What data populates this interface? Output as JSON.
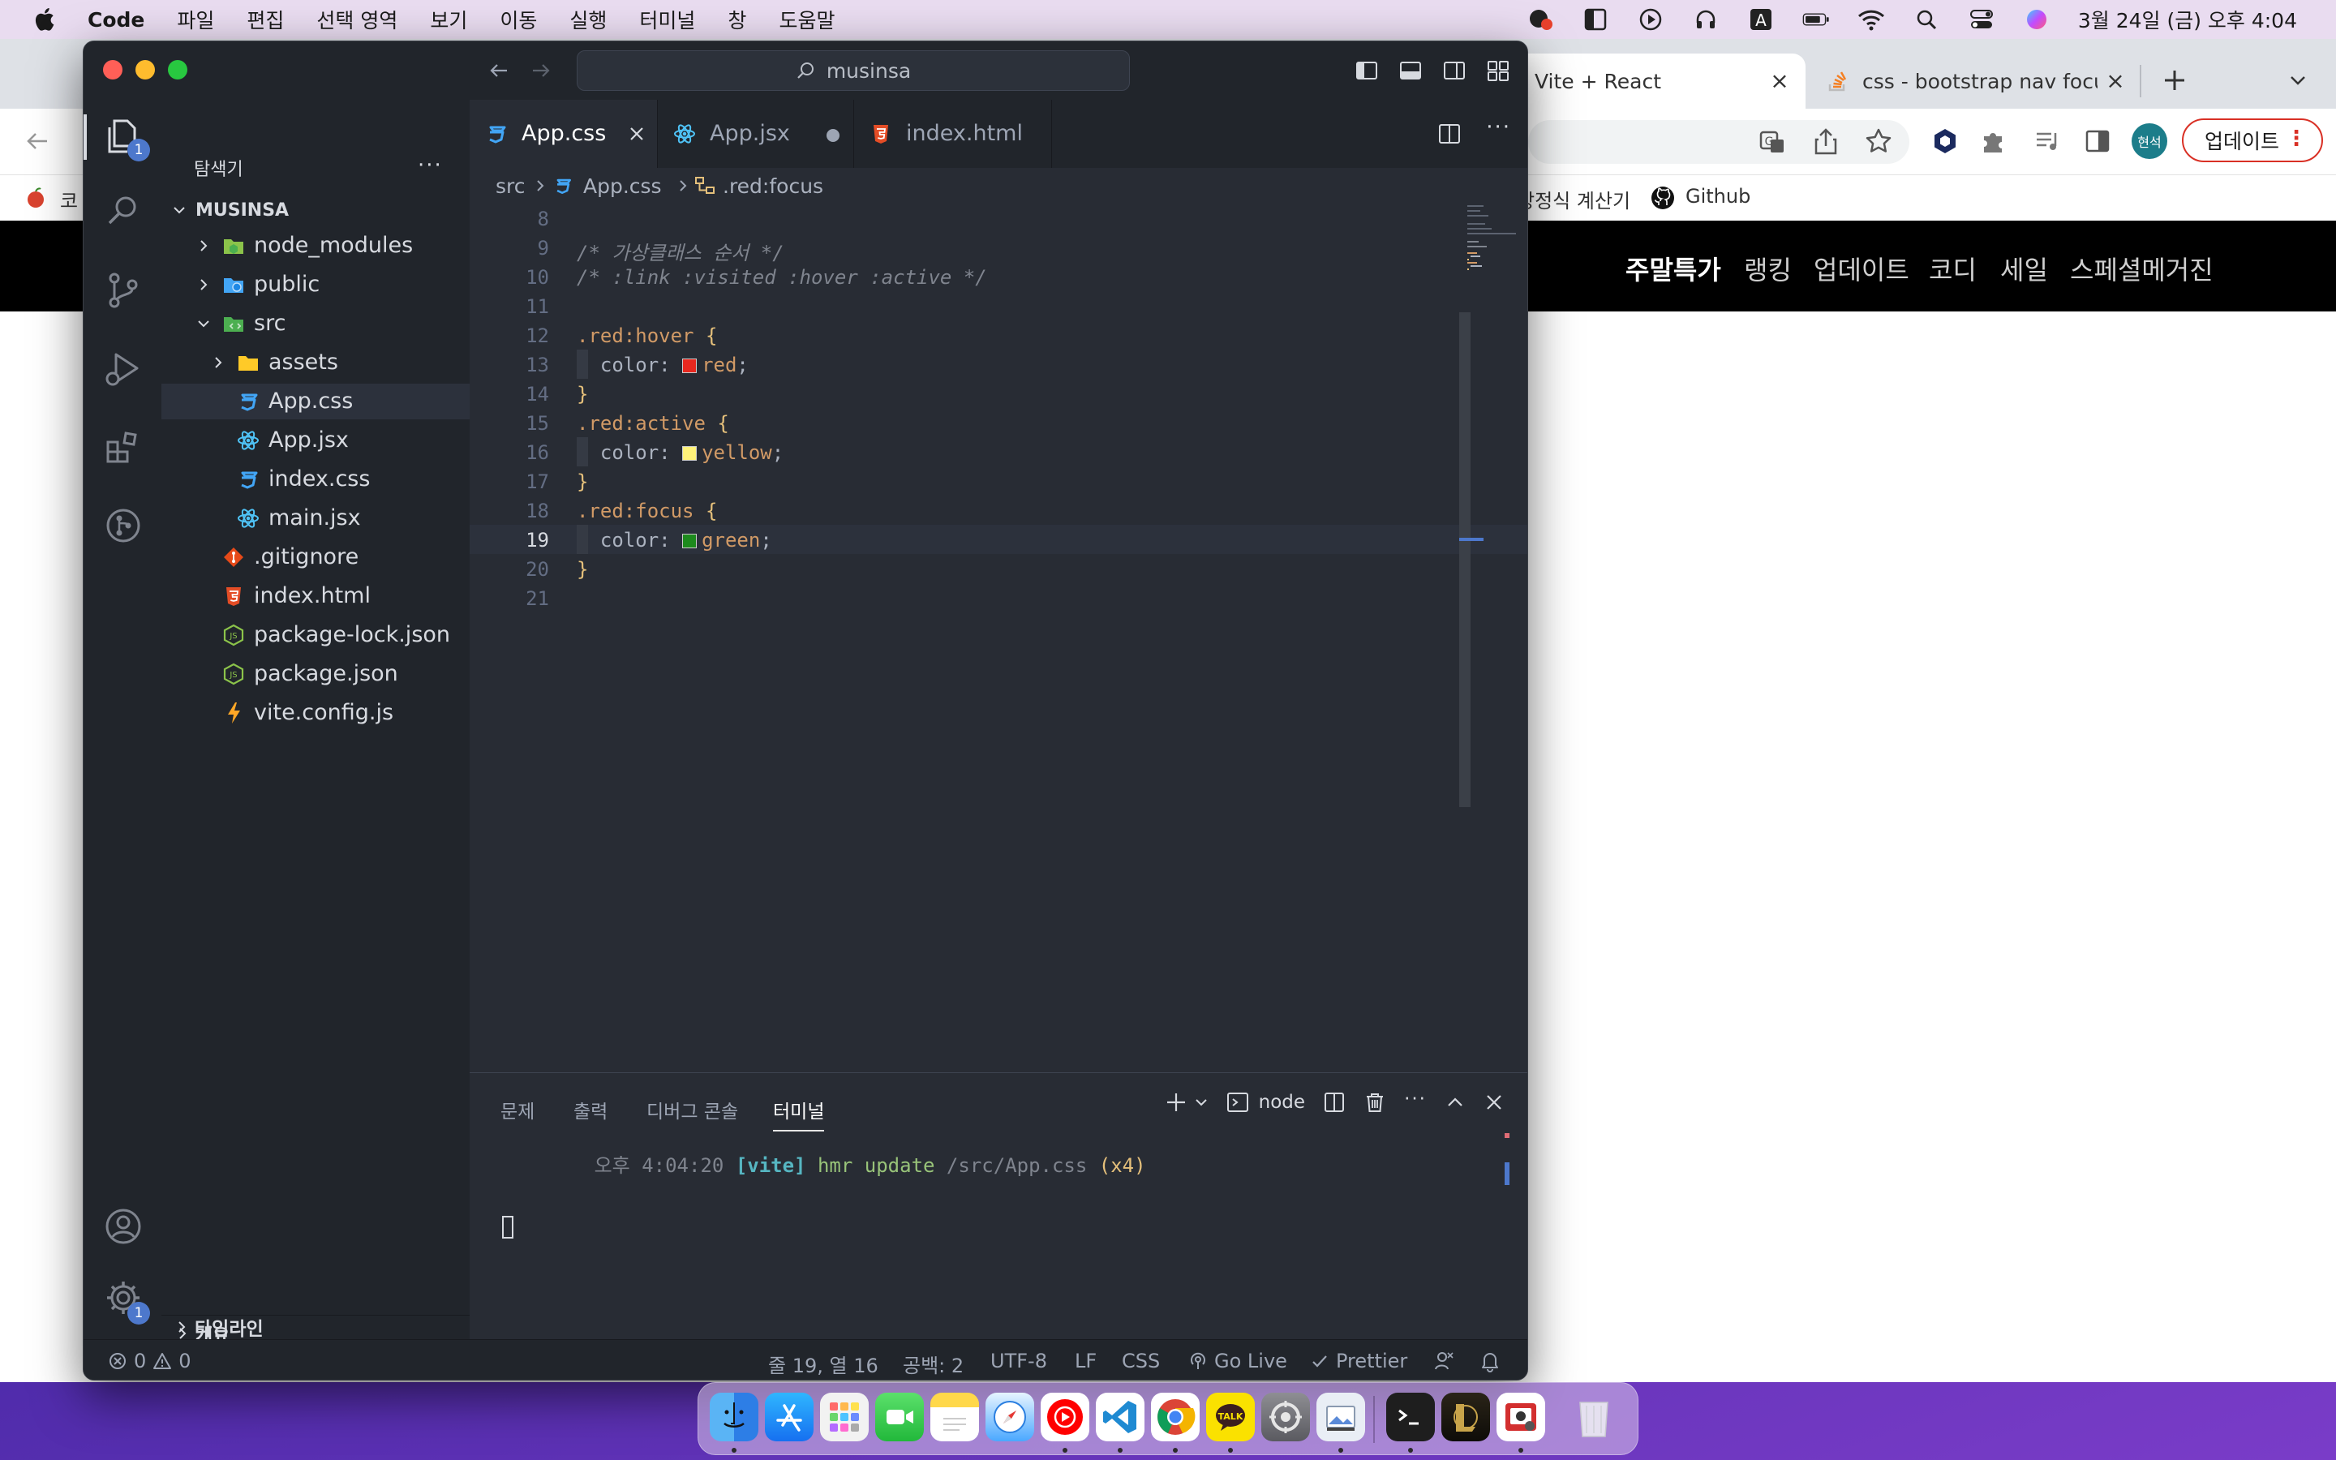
{
  "menubar": {
    "app_name": "Code",
    "items": [
      "파일",
      "편집",
      "선택 영역",
      "보기",
      "이동",
      "실행",
      "터미널",
      "창",
      "도움말"
    ],
    "clock": "3월 24일 (금) 오후 4:04"
  },
  "chrome": {
    "tabs": [
      {
        "title": "Vite + React"
      },
      {
        "title": "css - bootstrap nav focu"
      }
    ],
    "update_label": "업데이트",
    "avatar_label": "현석",
    "bookmarks": {
      "left": "코",
      "calc": "방정식 계산기",
      "github": "Github"
    },
    "site_nav": [
      "주말특가",
      "랭킹",
      "업데이트",
      "코디",
      "세일",
      "스페셜메거진"
    ]
  },
  "vscode": {
    "search_text": "musinsa",
    "explorer_title": "탐색기",
    "project": "MUSINSA",
    "explorer_badge": "1",
    "settings_badge": "1",
    "tree": [
      {
        "name": "node_modules",
        "type": "folder-node",
        "indent": 0,
        "chev": "right"
      },
      {
        "name": "public",
        "type": "folder-public",
        "indent": 0,
        "chev": "right"
      },
      {
        "name": "src",
        "type": "folder-src",
        "indent": 0,
        "chev": "down"
      },
      {
        "name": "assets",
        "type": "folder",
        "indent": 1,
        "chev": "right"
      },
      {
        "name": "App.css",
        "type": "css",
        "indent": 1,
        "selected": true
      },
      {
        "name": "App.jsx",
        "type": "react",
        "indent": 1
      },
      {
        "name": "index.css",
        "type": "css",
        "indent": 1
      },
      {
        "name": "main.jsx",
        "type": "react",
        "indent": 1
      },
      {
        "name": ".gitignore",
        "type": "git",
        "indent": 0
      },
      {
        "name": "index.html",
        "type": "html",
        "indent": 0
      },
      {
        "name": "package-lock.json",
        "type": "json",
        "indent": 0
      },
      {
        "name": "package.json",
        "type": "json",
        "indent": 0
      },
      {
        "name": "vite.config.js",
        "type": "vite",
        "indent": 0
      }
    ],
    "outline_label": "개요",
    "timeline_label": "타임라인",
    "tabs": [
      {
        "label": "App.css",
        "icon": "css",
        "active": true
      },
      {
        "label": "App.jsx",
        "icon": "react",
        "modified": true
      },
      {
        "label": "index.html",
        "icon": "html"
      }
    ],
    "breadcrumb": [
      "src",
      "App.css",
      ".red:focus"
    ],
    "code_lines": [
      {
        "n": "8",
        "t": ""
      },
      {
        "n": "9",
        "t": "/* 가상클래스 순서 */"
      },
      {
        "n": "10",
        "t": "/* :link :visited :hover :active */"
      },
      {
        "n": "11",
        "t": ""
      },
      {
        "n": "12",
        "t": ".red:hover {"
      },
      {
        "n": "13",
        "t": "  color: red;"
      },
      {
        "n": "14",
        "t": "}"
      },
      {
        "n": "15",
        "t": ".red:active {"
      },
      {
        "n": "16",
        "t": "  color: yellow;"
      },
      {
        "n": "17",
        "t": "}"
      },
      {
        "n": "18",
        "t": ".red:focus {"
      },
      {
        "n": "19",
        "t": "  color: green;"
      },
      {
        "n": "20",
        "t": "}"
      },
      {
        "n": "21",
        "t": ""
      }
    ],
    "swatches": {
      "red": "#e8281f",
      "yellow": "#fff27a",
      "green": "#1d8a1d"
    },
    "panel_tabs": [
      "문제",
      "출력",
      "디버그 콘솔",
      "터미널"
    ],
    "terminal_name": "node",
    "terminal": {
      "time": "오후 4:04:20",
      "tag": "[vite]",
      "msg": "hmr update",
      "path": "/src/App.css",
      "count": "(x4)"
    },
    "status": {
      "errors": "0",
      "warnings": "0",
      "position": "줄 19, 열 16",
      "spaces": "공백: 2",
      "encoding": "UTF-8",
      "eol": "LF",
      "language": "CSS",
      "golive": "Go Live",
      "prettier": "Prettier"
    }
  },
  "dock": [
    "Finder",
    "App Store",
    "Launchpad",
    "FaceTime",
    "Notes",
    "Safari",
    "YouTube Music",
    "VS Code",
    "Chrome",
    "KakaoTalk",
    "System Settings",
    "Preview",
    "Terminal",
    "League of Legends",
    "Photo Booth",
    "Trash"
  ]
}
